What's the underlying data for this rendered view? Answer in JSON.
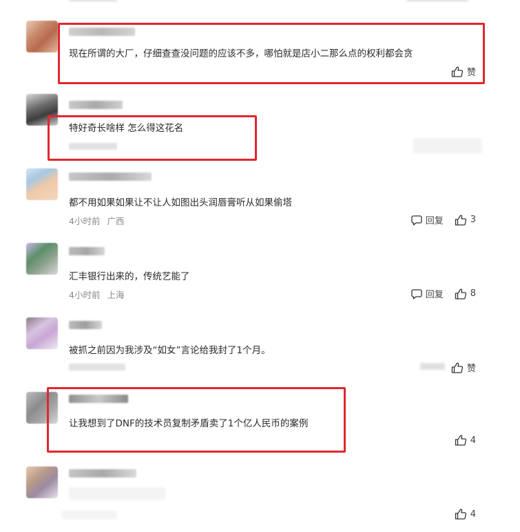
{
  "comments": [
    {
      "text": "现在所谓的大厂，仔细查查没问题的应该不多，哪怕就是店小二那么点的权利都会贪",
      "like_label": "赞"
    },
    {
      "text": "特好奇长啥样 怎么得这花名"
    },
    {
      "text": "都不用如果如果让不让人如图出头润唇膏听从如果偷塔",
      "time": "4小时前",
      "location": "广西",
      "reply_label": "回复",
      "likes": "3"
    },
    {
      "text": "汇丰银行出来的，传统艺能了",
      "time": "4小时前",
      "location": "上海",
      "reply_label": "回复",
      "likes": "8"
    },
    {
      "text": "被抓之前因为我涉及“如女”言论给我封了1个月。",
      "like_label": "赞"
    },
    {
      "text": "让我想到了DNF的技术员复制矛盾卖了1个亿人民币的案例",
      "likes": "4"
    },
    {
      "text": "",
      "likes": "4"
    }
  ],
  "icons": {
    "like": "thumbs-up-icon",
    "reply": "speech-bubble-icon"
  },
  "colors": {
    "highlight": "#e2252e",
    "meta": "#8a8a8a"
  }
}
